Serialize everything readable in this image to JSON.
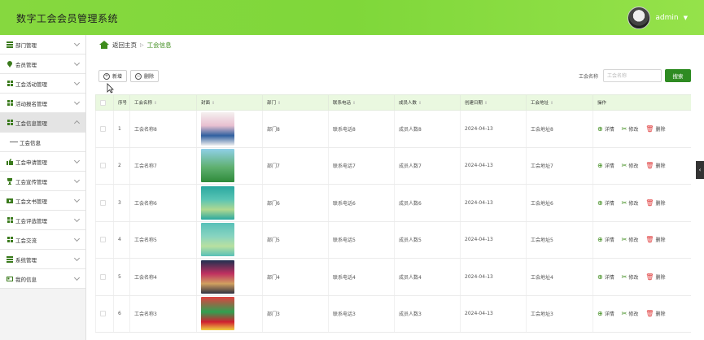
{
  "header": {
    "title": "数字工会会员管理系统",
    "username": "admin"
  },
  "sidebar": {
    "items": [
      {
        "label": "部门管理",
        "icon": "list-icon"
      },
      {
        "label": "会员管理",
        "icon": "pin-icon"
      },
      {
        "label": "工会活动管理",
        "icon": "grid-icon"
      },
      {
        "label": "活动报名管理",
        "icon": "grid-icon"
      },
      {
        "label": "工会信息管理",
        "icon": "grid-icon",
        "active": true,
        "children": [
          {
            "label": "工会信息"
          }
        ]
      },
      {
        "label": "工会申请管理",
        "icon": "thumb-icon"
      },
      {
        "label": "工会宣传管理",
        "icon": "trophy-icon"
      },
      {
        "label": "工会文书管理",
        "icon": "video-icon"
      },
      {
        "label": "工会评选管理",
        "icon": "grid-icon"
      },
      {
        "label": "工会交流",
        "icon": "grid-icon"
      },
      {
        "label": "系统管理",
        "icon": "list-icon"
      },
      {
        "label": "我的信息",
        "icon": "card-icon"
      }
    ]
  },
  "breadcrumb": {
    "home": "返回主页",
    "separator": "▷",
    "current": "工会信息"
  },
  "toolbar": {
    "add_label": "新增",
    "delete_label": "删除"
  },
  "search": {
    "label": "工会名称",
    "placeholder": "工会名称",
    "button": "搜索"
  },
  "table": {
    "headers": [
      "序号",
      "工会名称",
      "封面",
      "部门",
      "联系电话",
      "成员人数",
      "创建日期",
      "工会地址",
      "操作"
    ],
    "actions": {
      "detail": "详情",
      "edit": "修改",
      "delete": "删除"
    },
    "rows": [
      {
        "index": "1",
        "name": "工会名称8",
        "dept": "部门8",
        "phone": "联系电话8",
        "members": "成员人数8",
        "date": "2024-04-13",
        "address": "工会地址8"
      },
      {
        "index": "2",
        "name": "工会名称7",
        "dept": "部门7",
        "phone": "联系电话7",
        "members": "成员人数7",
        "date": "2024-04-13",
        "address": "工会地址7"
      },
      {
        "index": "3",
        "name": "工会名称6",
        "dept": "部门6",
        "phone": "联系电话6",
        "members": "成员人数6",
        "date": "2024-04-13",
        "address": "工会地址6"
      },
      {
        "index": "4",
        "name": "工会名称5",
        "dept": "部门5",
        "phone": "联系电话5",
        "members": "成员人数5",
        "date": "2024-04-13",
        "address": "工会地址5"
      },
      {
        "index": "5",
        "name": "工会名称4",
        "dept": "部门4",
        "phone": "联系电话4",
        "members": "成员人数4",
        "date": "2024-04-13",
        "address": "工会地址4"
      },
      {
        "index": "6",
        "name": "工会名称3",
        "dept": "部门3",
        "phone": "联系电话3",
        "members": "成员人数3",
        "date": "2024-04-13",
        "address": "工会地址3"
      }
    ]
  },
  "colors": {
    "accent": "#82d83e",
    "primary_button": "#2e8b22",
    "header_row": "#eaf8e0",
    "delete": "#e04040"
  }
}
